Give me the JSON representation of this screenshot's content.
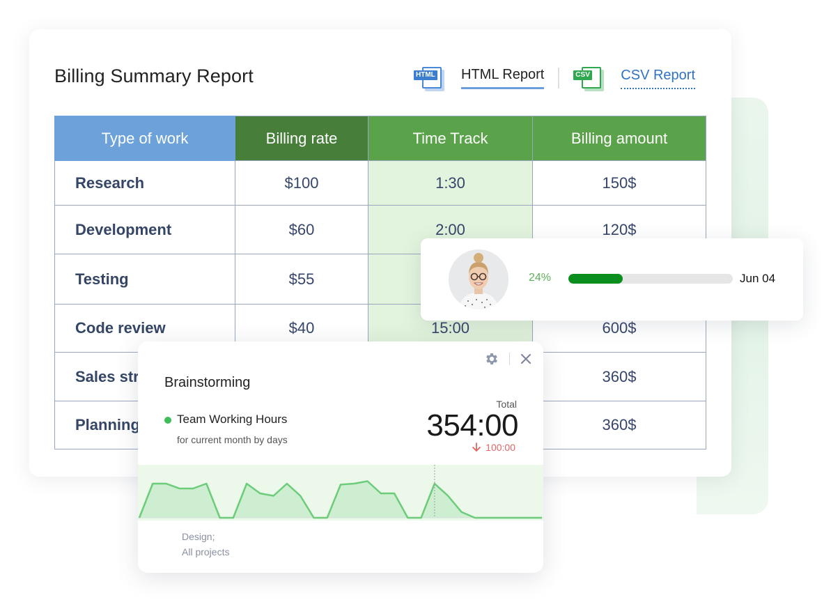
{
  "report": {
    "title": "Billing Summary Report",
    "tabs": [
      {
        "icon": "html-file-icon",
        "icon_tag": "HTML",
        "label": "HTML Report",
        "active": true
      },
      {
        "icon": "csv-file-icon",
        "icon_tag": "CSV",
        "label": "CSV Report",
        "active": false
      }
    ],
    "table": {
      "columns": [
        "Type of work",
        "Billing rate",
        "Time Track",
        "Billing amount"
      ],
      "rows": [
        {
          "work": "Research",
          "rate": "$100",
          "time": "1:30",
          "amount": "150$"
        },
        {
          "work": "Development",
          "rate": "$60",
          "time": "2:00",
          "amount": "120$"
        },
        {
          "work": "Testing",
          "rate": "$55",
          "time": "",
          "amount": ""
        },
        {
          "work": "Code review",
          "rate": "$40",
          "time": "15:00",
          "amount": "600$"
        },
        {
          "work": "Sales str",
          "rate": "",
          "time": "",
          "amount": "360$"
        },
        {
          "work": "Planning",
          "rate": "",
          "time": "",
          "amount": "360$"
        }
      ]
    },
    "colors": {
      "header_blue": "#6ca2d9",
      "header_dark_green": "#467e3a",
      "header_green": "#5aa34a",
      "track_bg": "#e2f4dd"
    }
  },
  "progress_card": {
    "avatar": "user-avatar",
    "percent_label": "24%",
    "progress_fraction": 0.33,
    "date": "Jun 04",
    "fill_color": "#0a8f1e"
  },
  "widget": {
    "title": "Brainstorming",
    "legend_label": "Team Working Hours",
    "legend_sub": "for current month  by days",
    "total_label": "Total",
    "total_value": "354:00",
    "delta": "100:00",
    "footer": [
      "Design;",
      "All projects"
    ],
    "chart_data": {
      "type": "area",
      "title": "Team Working Hours",
      "xlabel": "",
      "ylabel": "",
      "x": [
        0,
        1,
        2,
        3,
        4,
        5,
        6,
        7,
        8,
        9,
        10,
        11,
        12,
        13,
        14,
        15,
        16,
        17,
        18,
        19,
        20,
        21,
        22,
        23,
        24,
        25,
        26,
        27,
        28,
        29,
        30
      ],
      "values": [
        0,
        7,
        7,
        6,
        6,
        7,
        0,
        0,
        7,
        5,
        4.5,
        7,
        4.5,
        0,
        0,
        6.8,
        7,
        7.5,
        5,
        5,
        0,
        0,
        7,
        4.5,
        1.2,
        0,
        0,
        0,
        0,
        0,
        0
      ],
      "ylim": [
        0,
        10
      ],
      "marker_x": 22,
      "line_color": "#6ccc7a",
      "fill_color": "#cdeed0",
      "grid": false
    }
  }
}
